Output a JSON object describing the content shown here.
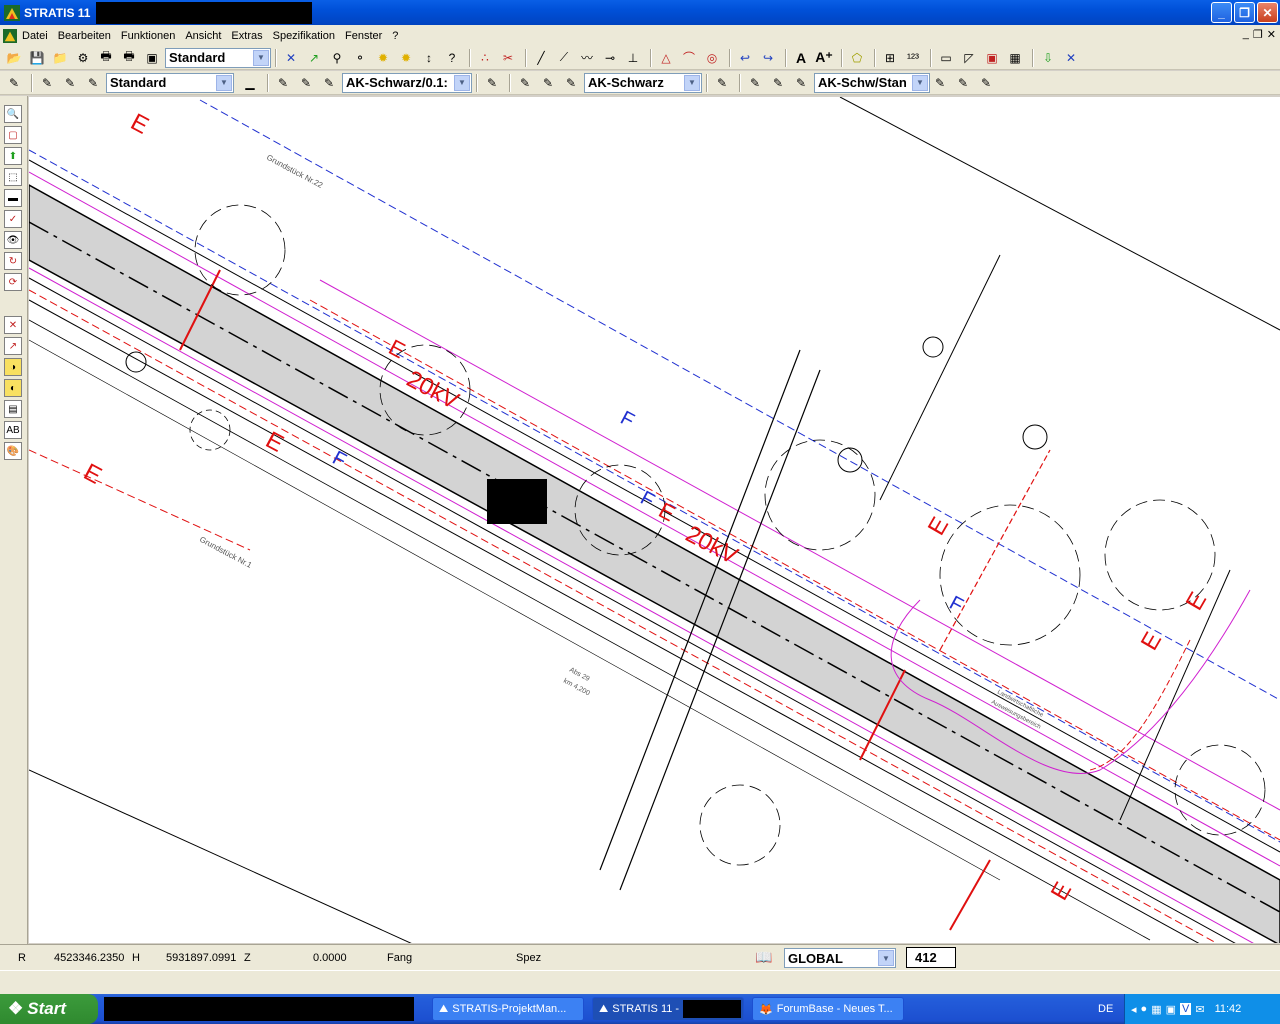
{
  "window": {
    "title": "STRATIS 11"
  },
  "menu": [
    "Datei",
    "Bearbeiten",
    "Funktionen",
    "Ansicht",
    "Extras",
    "Spezifikation",
    "Fenster",
    "?"
  ],
  "toolbar1": {
    "style_combo": "Standard"
  },
  "toolbar2": {
    "combo1": "Standard",
    "combo2": "AK-Schwarz/0.1:",
    "combo3": "AK-Schwarz",
    "combo4": "AK-Schw/Stan"
  },
  "drawing": {
    "labels": {
      "voltage1": "20kV",
      "voltage2": "20kV",
      "grundstueck22": "Grundstück Nr.22",
      "grundstueck1": "Grundstück Nr.1",
      "abs": "Abs 29",
      "km": "km 4,200",
      "landw1": "Landwirtschaftliche",
      "landw2": "Ausweisungsbereich"
    },
    "markers": {
      "E": "E",
      "F": "F"
    },
    "colors": {
      "road": "#d3d3d3",
      "power": "#e01010",
      "gas": "#2030d0",
      "property": "#d020d0"
    }
  },
  "status": {
    "r_label": "R",
    "r_value": "4523346.2350",
    "h_label": "H",
    "h_value": "5931897.0991",
    "z_label": "Z",
    "z_value": "0.0000",
    "fang": "Fang",
    "spez": "Spez",
    "coord_system": "GLOBAL",
    "scale": "412"
  },
  "taskbar": {
    "start": "Start",
    "tasks": [
      "STRATIS-ProjektMan...",
      "STRATIS 11 -",
      "ForumBase - Neues T..."
    ],
    "lang": "DE",
    "clock": "11:42"
  }
}
